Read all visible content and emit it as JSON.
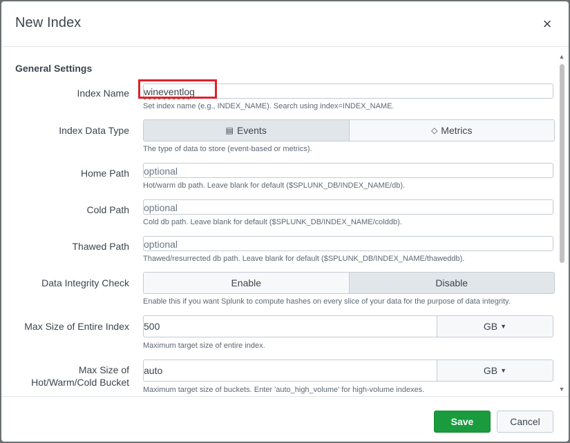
{
  "modal": {
    "title": "New Index",
    "close_icon": "close-icon"
  },
  "general": {
    "section_title": "General Settings",
    "index_name": {
      "label": "Index Name",
      "value": "wineventlog",
      "help": "Set index name (e.g., INDEX_NAME). Search using index=INDEX_NAME."
    },
    "index_data_type": {
      "label": "Index Data Type",
      "options": [
        "Events",
        "Metrics"
      ],
      "option_icons": [
        "document-icon",
        "tag-icon"
      ],
      "selected": "Events",
      "help": "The type of data to store (event-based or metrics)."
    },
    "home_path": {
      "label": "Home Path",
      "placeholder": "optional",
      "help": "Hot/warm db path. Leave blank for default ($SPLUNK_DB/INDEX_NAME/db)."
    },
    "cold_path": {
      "label": "Cold Path",
      "placeholder": "optional",
      "help": "Cold db path. Leave blank for default ($SPLUNK_DB/INDEX_NAME/colddb)."
    },
    "thawed_path": {
      "label": "Thawed Path",
      "placeholder": "optional",
      "help": "Thawed/resurrected db path. Leave blank for default ($SPLUNK_DB/INDEX_NAME/thaweddb)."
    },
    "data_integrity": {
      "label": "Data Integrity Check",
      "options": [
        "Enable",
        "Disable"
      ],
      "selected": "Disable",
      "help": "Enable this if you want Splunk to compute hashes on every slice of your data for the purpose of data integrity."
    },
    "max_size_index": {
      "label": "Max Size of Entire Index",
      "value": "500",
      "unit": "GB",
      "help": "Maximum target size of entire index."
    },
    "max_size_bucket": {
      "label_line1": "Max Size of",
      "label_line2": "Hot/Warm/Cold Bucket",
      "value": "auto",
      "unit": "GB",
      "help": "Maximum target size of buckets. Enter 'auto_high_volume' for high-volume indexes."
    }
  },
  "footer": {
    "save_label": "Save",
    "cancel_label": "Cancel"
  },
  "colors": {
    "save_button": "#1a9c3e",
    "highlight_box": "#e0202a"
  }
}
